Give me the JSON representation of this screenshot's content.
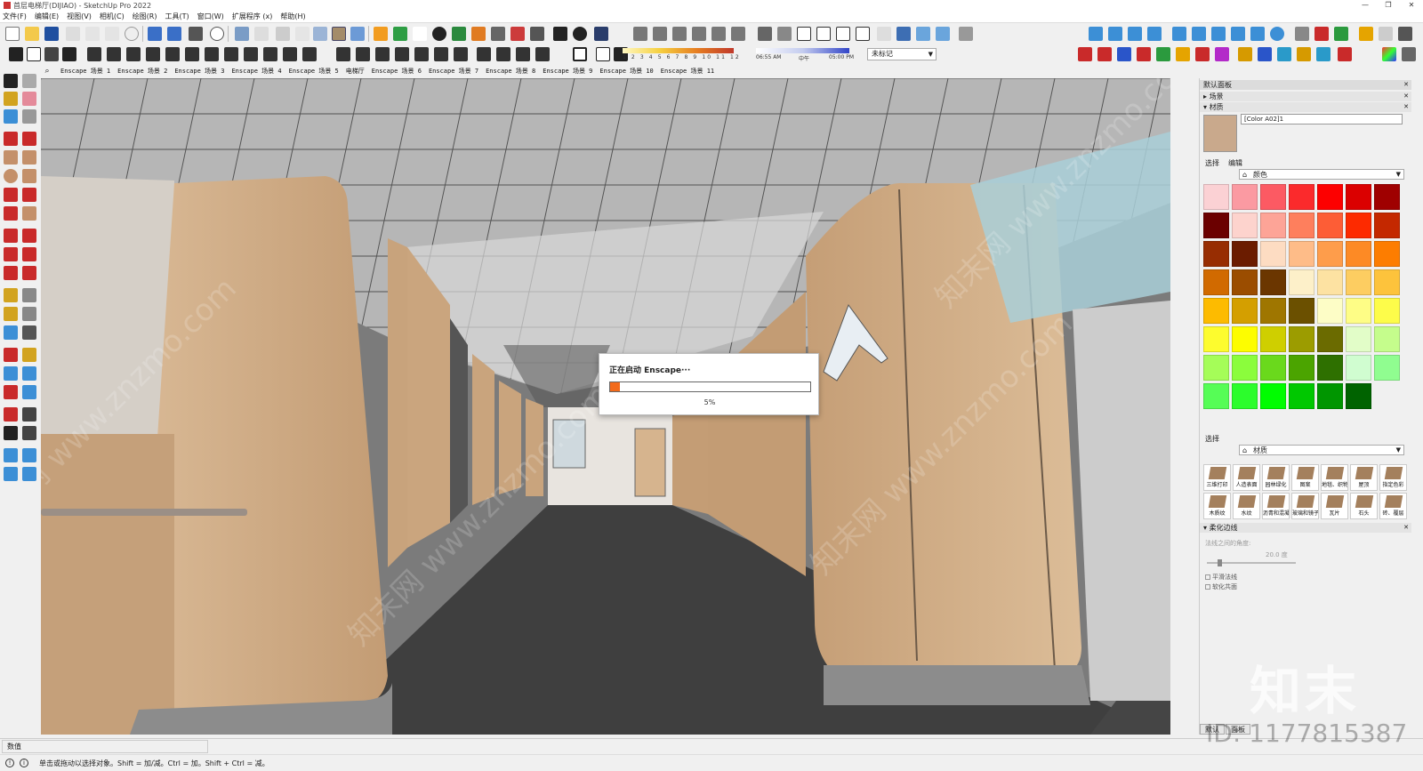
{
  "window": {
    "title": "首层电梯厅(DIJIAO) - SketchUp Pro 2022",
    "controls": [
      "—",
      "❐",
      "✕"
    ]
  },
  "menu": [
    "文件(F)",
    "编辑(E)",
    "视图(V)",
    "相机(C)",
    "绘图(R)",
    "工具(T)",
    "窗口(W)",
    "扩展程序 (x)",
    "帮助(H)"
  ],
  "timebar": {
    "months": "1 2 3 4 5 6 7 8 9 10 11 12",
    "time_start": "06:55 AM",
    "time_mid": "中午",
    "time_end": "05:00 PM"
  },
  "tag_select": {
    "value": "未标记"
  },
  "scenes": [
    "Enscape 场景 1",
    "Enscape 场景 2",
    "Enscape 场景 3",
    "Enscape 场景 4",
    "Enscape 场景 5",
    "电梯厅",
    "Enscape 场景 6",
    "Enscape 场景 7",
    "Enscape 场景 8",
    "Enscape 场景 9",
    "Enscape 场景 10",
    "Enscape 场景 11"
  ],
  "dialog": {
    "title": "正在启动 Enscape···",
    "progress": 0.05,
    "progress_text": "5%"
  },
  "panel": {
    "title": "默认面板",
    "scenes_header": "场景",
    "materials_header": "材质",
    "material_name": "[Color A02]1",
    "tab_select": "选择",
    "tab_edit": "编辑",
    "library_top": "颜色",
    "select2_label": "选择",
    "library_bottom": "材质",
    "soften_header": "柔化边线",
    "soften_angle_label": "法线之间的角度:",
    "soften_angle_value": "20.0 度",
    "smooth_normals": "平滑法线",
    "soften_coplanar": "软化共面",
    "bottom_tabs": [
      "默认",
      "面板"
    ]
  },
  "color_swatches": [
    "#fbd1d4",
    "#fb9aa2",
    "#fc5a63",
    "#fb2a2c",
    "#fd0000",
    "#db0000",
    "#9f0000",
    "#6b0000",
    "#fdd3cd",
    "#fda497",
    "#fe7f5d",
    "#fd5d36",
    "#fd2a00",
    "#c42800",
    "#972d02",
    "#6b1c00",
    "#fddcc2",
    "#febc88",
    "#fe9d4b",
    "#fd8a25",
    "#fd7d00",
    "#d16a00",
    "#9b4d00",
    "#6b3600",
    "#fdf0c9",
    "#fde2a2",
    "#fdcd61",
    "#fdc33c",
    "#fdbb00",
    "#d49f00",
    "#9f7600",
    "#6b5000",
    "#fdfdc6",
    "#fefd86",
    "#fdfc4a",
    "#fdfc2e",
    "#fdfd00",
    "#cfcf00",
    "#9c9c00",
    "#6b6b00",
    "#e2fdc8",
    "#c5fd8c",
    "#a5fd58",
    "#8bfd3c",
    "#6ad91c",
    "#4ba400",
    "#2e7000",
    "#d0fdd0",
    "#90fd90",
    "#56fd56",
    "#2cfd2c",
    "#00fd00",
    "#00c800",
    "#009600",
    "#006300"
  ],
  "materials": [
    "三维打印",
    "人造表面",
    "园林绿化",
    "图案",
    "地毯、织物",
    "屋顶",
    "指定色彩",
    "木质纹",
    "水纹",
    "沥青和混凝土",
    "玻璃和镜子",
    "瓦片",
    "石头",
    "砖、覆层"
  ],
  "status": {
    "values_label": "数值",
    "message": "单击或拖动以选择对象。Shift = 加/减。Ctrl = 加。Shift + Ctrl = 减。"
  },
  "watermark": {
    "brand": "知末",
    "id": "ID: 1177815387"
  },
  "colors": {
    "accent": "#f26a1b",
    "wall_wood": "#c9a17a",
    "floor": "#424242",
    "ceiling": "#bdbdbd"
  }
}
